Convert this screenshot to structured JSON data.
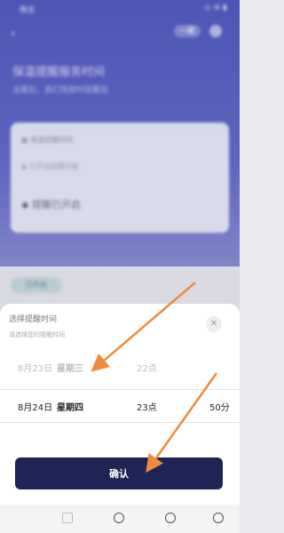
{
  "status_bar": {
    "left": "晚安",
    "right": "◎ ⊕ ▮"
  },
  "header": {
    "back_icon": "back-icon",
    "pill_label": "一键"
  },
  "background": {
    "headline": "保温提醒服务时间",
    "subline": "设置后，我们将按时提醒您",
    "card": {
      "line1": "▣ 保温提醒时间",
      "line2": "◆ 已开启提醒功能",
      "line3": "◆ 提醒已开启"
    },
    "tag": "已开启"
  },
  "picker": {
    "title": "选择提醒时间",
    "subtitle": "请选择您的提醒时间",
    "close_icon": "close-icon",
    "prev_row": {
      "date": "8月23日",
      "weekday": "星期三",
      "hour": "22点",
      "minute": ""
    },
    "selected_row": {
      "date": "8月24日",
      "weekday": "星期四",
      "hour": "23点",
      "minute": "50分"
    },
    "confirm_label": "确认"
  },
  "annotations": {
    "arrow_color": "#f08a3a"
  },
  "nav_bar": {
    "items": [
      "square-icon",
      "circle-icon",
      "circle-icon",
      "back-triangle-icon"
    ]
  }
}
